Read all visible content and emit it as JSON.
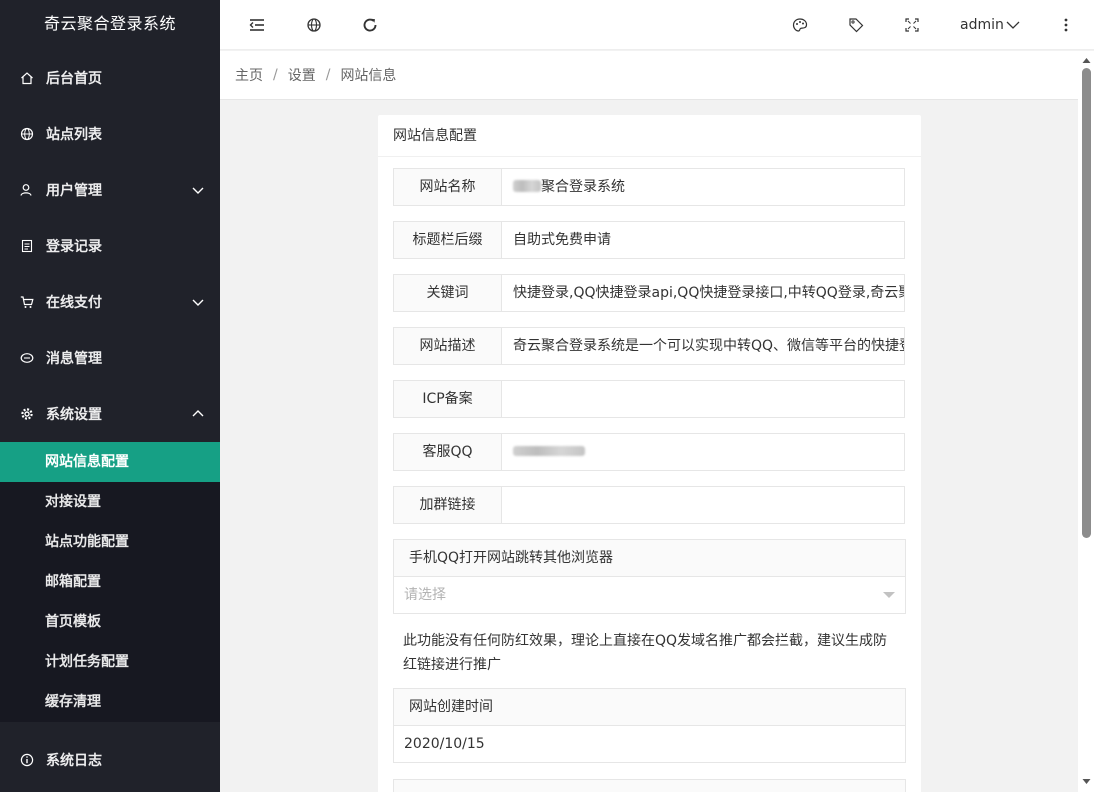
{
  "app": {
    "title": "奇云聚合登录系统"
  },
  "sidebar": {
    "items": [
      {
        "label": "后台首页",
        "icon": "home-icon"
      },
      {
        "label": "站点列表",
        "icon": "globe-icon"
      },
      {
        "label": "用户管理",
        "icon": "user-icon",
        "expandable": true
      },
      {
        "label": "登录记录",
        "icon": "document-icon"
      },
      {
        "label": "在线支付",
        "icon": "cart-icon",
        "expandable": true
      },
      {
        "label": "消息管理",
        "icon": "chat-icon"
      },
      {
        "label": "系统设置",
        "icon": "gear-icon",
        "expanded": true
      }
    ],
    "submenu": [
      {
        "label": "网站信息配置",
        "active": true
      },
      {
        "label": "对接设置"
      },
      {
        "label": "站点功能配置"
      },
      {
        "label": "邮箱配置"
      },
      {
        "label": "首页模板"
      },
      {
        "label": "计划任务配置"
      },
      {
        "label": "缓存清理"
      }
    ],
    "bottom_item": {
      "label": "系统日志",
      "icon": "info-icon"
    }
  },
  "header": {
    "user": "admin",
    "icons": [
      "menu-collapse-icon",
      "globe-icon",
      "refresh-icon",
      "palette-icon",
      "tag-icon",
      "fullscreen-icon",
      "more-vertical-icon"
    ]
  },
  "breadcrumb": {
    "home": "主页",
    "section": "设置",
    "current": "网站信息"
  },
  "form": {
    "card_title": "网站信息配置",
    "fields": [
      {
        "label": "网站名称",
        "value": "聚合登录系统",
        "redacted_prefix": true
      },
      {
        "label": "标题栏后缀",
        "value": "自助式免费申请"
      },
      {
        "label": "关键词",
        "value": "快捷登录,QQ快捷登录api,QQ快捷登录接口,中转QQ登录,奇云聚合登录系统"
      },
      {
        "label": "网站描述",
        "value": "奇云聚合登录系统是一个可以实现中转QQ、微信等平台的快捷登录系统"
      },
      {
        "label": "ICP备案",
        "value": ""
      },
      {
        "label": "客服QQ",
        "value": "",
        "redacted": true
      },
      {
        "label": "加群链接",
        "value": ""
      }
    ],
    "browser_jump": {
      "label": "手机QQ打开网站跳转其他浏览器",
      "placeholder": "请选择"
    },
    "note": "此功能没有任何防红效果，理论上直接在QQ发域名推广都会拦截，建议生成防红链接进行推广",
    "created": {
      "label": "网站创建时间",
      "value": "2020/10/15"
    }
  },
  "colors": {
    "sidebar_bg": "#20222a",
    "submenu_bg": "#171821",
    "accent": "#16a085"
  }
}
